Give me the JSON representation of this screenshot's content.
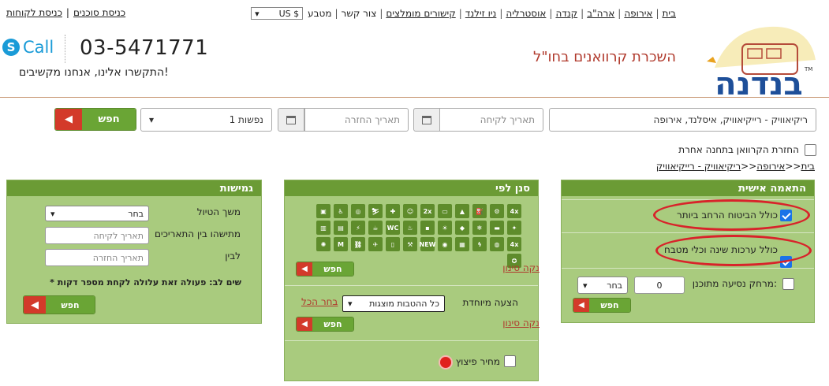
{
  "nav": {
    "items": [
      "בית",
      "אירופה",
      "ארה\"ב",
      "קנדה",
      "אוסטרליה",
      "ניו זילנד",
      "קישורים מומלצים",
      "צור קשר"
    ],
    "currency_label": "מטבע",
    "currency_value": "US $"
  },
  "left_links": [
    "כניסת סוכנים",
    "כניסת לקוחות"
  ],
  "header": {
    "logo_text": "בנדנה",
    "logo_tm": "TM",
    "headline": "השכרת קרוואנים בחו\"ל",
    "phone": "03-5471771",
    "skype_label": "Call",
    "call_us": "התקשרו אלינו, אנחנו מקשיבים!"
  },
  "search": {
    "location_value": "ריקיאוויק - רייקיאוויק, איסלנד, אירופה",
    "pickup_placeholder": "תאריך לקיחה",
    "return_placeholder": "תאריך החזרה",
    "passengers_value": "1 נפשות",
    "search_label": "חפש",
    "return_other_label": "החזרת הקרוואן בתחנה אחרת"
  },
  "breadcrumb": [
    "בית",
    "אירופה",
    "ריקיאוויק - רייקיאוויק"
  ],
  "personal": {
    "title": "התאמה אישית",
    "opt1": "כולל הביטוח הרחב ביותר",
    "opt2": "כולל ערכות שינה וכלי מטבח",
    "distance_label": "מרחק נסיעה מתוכנן:",
    "distance_value": "0",
    "select_value": "בחר",
    "search_label": "חפש"
  },
  "filter": {
    "title": "סנן לפי",
    "icons": [
      "4x4",
      "gear",
      "fuel",
      "vacuum",
      "tv",
      "2x2",
      "family",
      "key",
      "ski",
      "grill",
      "wheelchair",
      "gas",
      "dog",
      "caravan",
      "ac",
      "ind",
      "solar",
      "bus",
      "kitchen",
      "wc",
      "drink",
      "power",
      "toilet",
      "shower",
      "4x4b",
      "outlet",
      "flash",
      "bed",
      "water",
      "new",
      "tools",
      "fridge",
      "gps",
      "towing",
      "m",
      "lighting",
      "pref"
    ],
    "clear_label": "נקה סינון",
    "search_label": "חפש",
    "special_label": "הצעה מיוחדת",
    "special_value": "כל ההטבות מוצגות",
    "select_all": "בחר הכל",
    "clear_label2": "נקה סינון",
    "search_label2": "חפש",
    "price_label": "מחיר פיצוץ"
  },
  "flex": {
    "title": "גמישות",
    "duration_label": "משך הטיול",
    "duration_value": "בחר",
    "between_label": "מתישהו בין התאריכים",
    "from_placeholder": "תאריך לקיחה",
    "to_label": "לבין",
    "to_placeholder": "תאריך החזרה",
    "note": "* שים לב: פעולה זאת עלולה לקחת מספר דקות",
    "search_label": "חפש"
  }
}
